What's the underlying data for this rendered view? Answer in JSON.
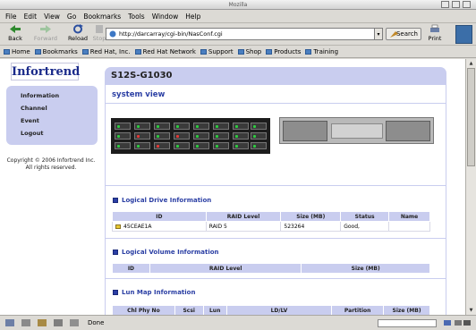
{
  "window": {
    "title": "Mozilla"
  },
  "menu": {
    "items": [
      "File",
      "Edit",
      "View",
      "Go",
      "Bookmarks",
      "Tools",
      "Window",
      "Help"
    ]
  },
  "toolbar": {
    "back_label": "Back",
    "forward_label": "Forward",
    "reload_label": "Reload",
    "stop_label": "Stop",
    "url": "http://darcarray/cgi-bin/NasConf.cgi",
    "search_label": "Search",
    "print_label": "Print"
  },
  "bookmarks": {
    "items": [
      "Home",
      "Bookmarks",
      "Red Hat, Inc.",
      "Red Hat Network",
      "Support",
      "Shop",
      "Products",
      "Training"
    ]
  },
  "sidebar": {
    "logo": "Infortrend",
    "nav": [
      "Information",
      "Channel",
      "Event",
      "Logout"
    ],
    "copyright": "Copyright © 2006 Infortrend Inc. All rights reserved."
  },
  "page": {
    "model": "S12S-G1030",
    "view_title": "system view"
  },
  "logical_drive": {
    "title": "Logical Drive Information",
    "columns": [
      "ID",
      "RAID Level",
      "Size (MB)",
      "Status",
      "Name"
    ],
    "rows": [
      [
        "45CEAE1A",
        "RAID 5",
        "523264",
        "Good,",
        ""
      ]
    ]
  },
  "logical_volume": {
    "title": "Logical Volume Information",
    "columns": [
      "ID",
      "RAID Level",
      "Size (MB)"
    ]
  },
  "lun_map": {
    "title": "Lun Map Information",
    "columns": [
      "Chl Phy No",
      "Scsi",
      "Lun",
      "LD/LV",
      "Partition",
      "Size (MB)"
    ]
  },
  "status": {
    "text": "Done"
  },
  "colors": {
    "panel": "#c9cdef",
    "heading": "#2b3fa4",
    "led_green": "#2ecc40",
    "led_red": "#e53935"
  }
}
